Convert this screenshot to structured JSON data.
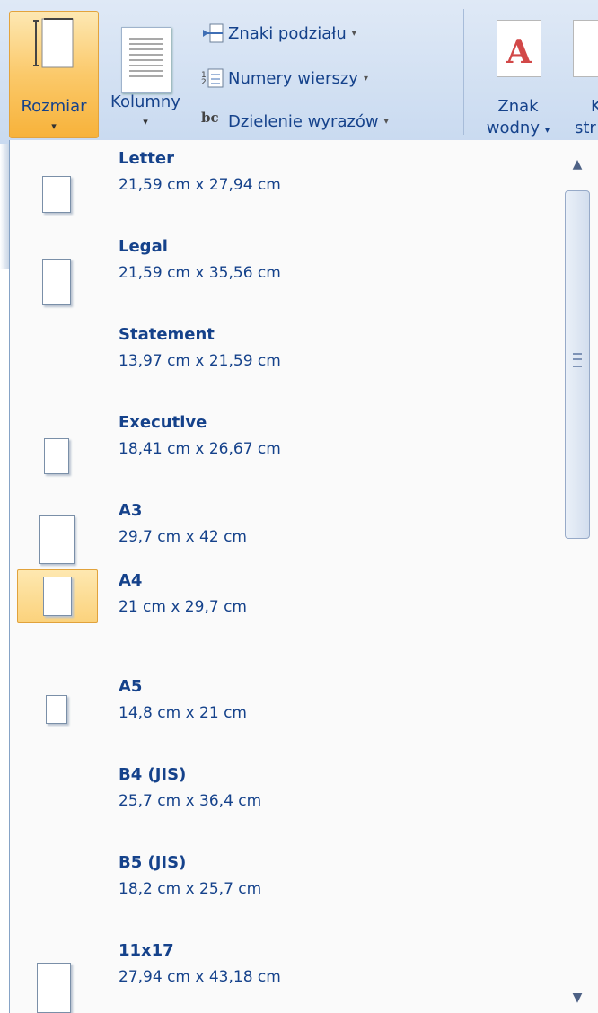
{
  "ribbon": {
    "rozmiar": {
      "label": "Rozmiar",
      "arrow": "▾"
    },
    "kolumny": {
      "label": "Kolumny",
      "arrow": "▾"
    },
    "znaki_podzialu": {
      "label": "Znaki podziału",
      "arrow": "▾"
    },
    "numery_wierszy": {
      "label": "Numery wierszy",
      "arrow": "▾"
    },
    "dzielenie": {
      "label": "Dzielenie wyrazów",
      "arrow": "▾",
      "icon_text": "bc"
    },
    "znak_wodny": {
      "line1": "Znak",
      "line2": "wodny",
      "arrow": "▾",
      "icon_letter": "A"
    },
    "kolor_strony": {
      "line1": "K",
      "line2": "str"
    }
  },
  "sizes": [
    {
      "name": "Letter",
      "dims": "21,59 cm x 27,94 cm"
    },
    {
      "name": "Legal",
      "dims": "21,59 cm x 35,56 cm"
    },
    {
      "name": "Statement",
      "dims": "13,97 cm x 21,59 cm"
    },
    {
      "name": "Executive",
      "dims": "18,41 cm x 26,67 cm"
    },
    {
      "name": "A3",
      "dims": "29,7 cm x 42 cm"
    },
    {
      "name": "A4",
      "dims": "21 cm x 29,7 cm",
      "selected": true
    },
    {
      "name": "A5",
      "dims": "14,8 cm x 21 cm"
    },
    {
      "name": "B4 (JIS)",
      "dims": "25,7 cm x 36,4 cm"
    },
    {
      "name": "B5 (JIS)",
      "dims": "18,2 cm x 25,7 cm"
    },
    {
      "name": "11x17",
      "dims": "27,94 cm x 43,18 cm"
    }
  ],
  "scrollbar": {
    "up": "▲",
    "down": "▼"
  }
}
